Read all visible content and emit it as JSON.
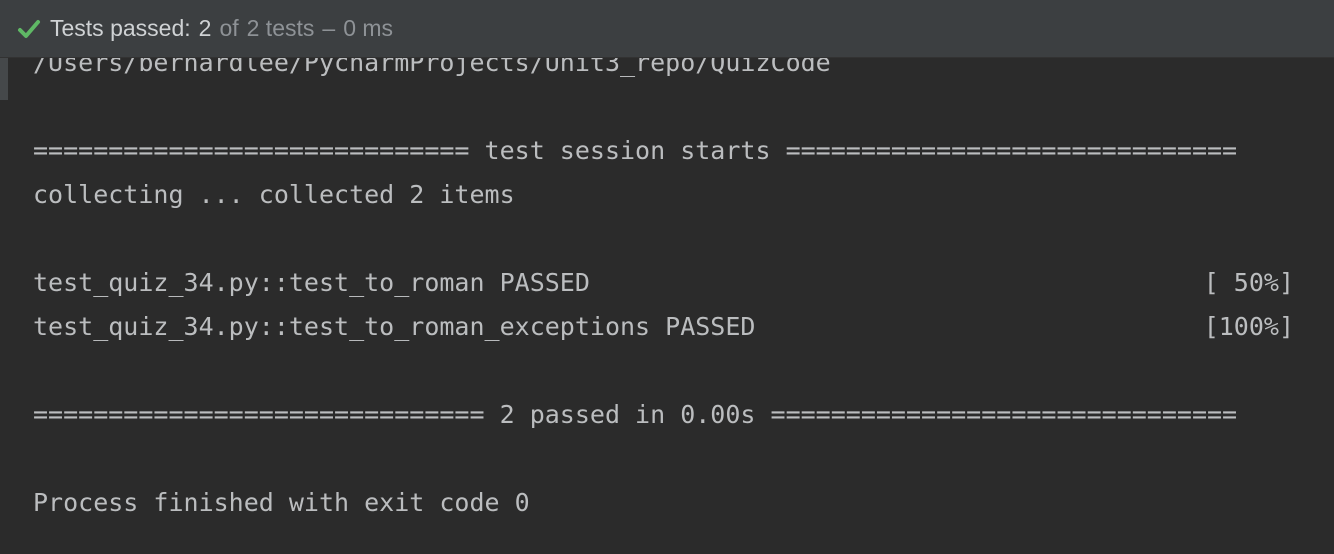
{
  "header": {
    "icon": "check-icon",
    "label": "Tests passed:",
    "passed_count": "2",
    "of_text": "of",
    "total_text": "2 tests",
    "dash": "–",
    "time": "0 ms",
    "accent_color": "#5fb865"
  },
  "console": {
    "path_line": "/Users/bernardlee/PycharmProjects/Unit3_repo/QuizCode",
    "session_line": "============================= test session starts ==============================",
    "collecting_line": "collecting ... collected 2 items",
    "tests": [
      {
        "name": "test_quiz_34.py::test_to_roman PASSED",
        "progress": "[ 50%]"
      },
      {
        "name": "test_quiz_34.py::test_to_roman_exceptions PASSED",
        "progress": "[100%]"
      }
    ],
    "summary_line": "============================== 2 passed in 0.00s ===============================",
    "exit_line": "Process finished with exit code 0"
  }
}
